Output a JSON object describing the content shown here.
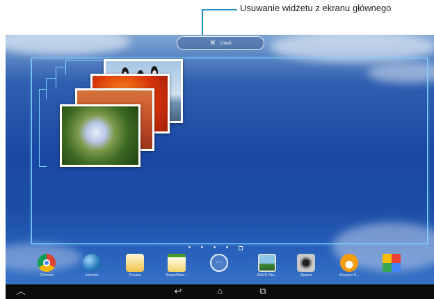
{
  "callout": {
    "text": "Usuwanie widżetu z ekranu głównego"
  },
  "remove_bar": {
    "label": "Usuń"
  },
  "dock": {
    "apps": [
      {
        "label": "Chrome",
        "icon": "chrome-icon"
      },
      {
        "label": "Internet",
        "icon": "globe-icon"
      },
      {
        "label": "Poczta",
        "icon": "mail-icon"
      },
      {
        "label": "SuperNote...",
        "icon": "notepad-icon"
      },
      {
        "label": "",
        "icon": "all-apps-icon"
      },
      {
        "label": "ASUS Stu...",
        "icon": "gallery-icon"
      },
      {
        "label": "Aparat",
        "icon": "camera-icon"
      },
      {
        "label": "Muzyka P...",
        "icon": "headphones-icon"
      },
      {
        "label": "",
        "icon": "google-folder-icon"
      }
    ]
  },
  "navbar": {
    "up_icon": "up-arrow-icon",
    "back_icon": "back-icon",
    "home_icon": "home-icon",
    "recents_icon": "recents-icon"
  },
  "colors": {
    "accent": "#1e8fc6",
    "frame": "#7fd3ff"
  }
}
